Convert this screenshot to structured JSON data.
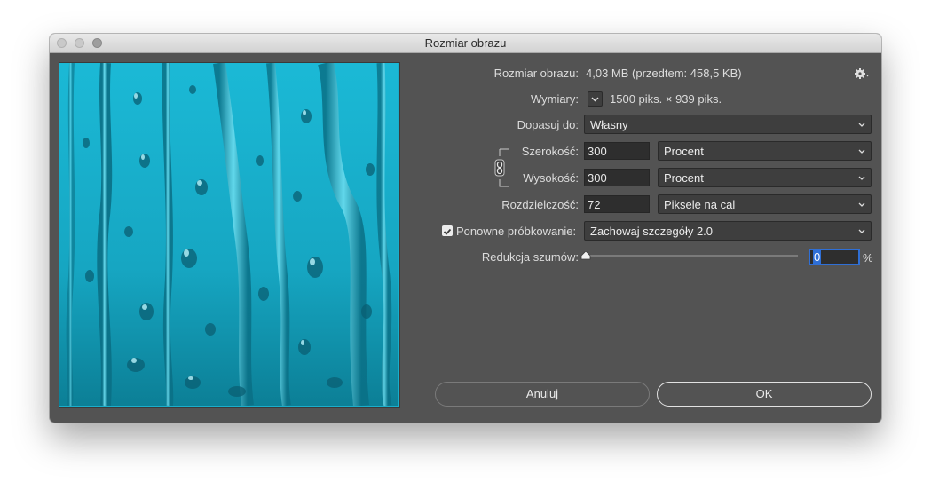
{
  "window": {
    "title": "Rozmiar obrazu"
  },
  "info": {
    "image_size_label": "Rozmiar obrazu:",
    "image_size_value": "4,03 MB (przedtem: 458,5 KB)",
    "dimensions_label": "Wymiary:",
    "dimensions_value": "1500 piks. × 939 piks."
  },
  "fit_to": {
    "label": "Dopasuj do:",
    "value": "Własny"
  },
  "width": {
    "label": "Szerokość:",
    "value": "300",
    "unit": "Procent"
  },
  "height": {
    "label": "Wysokość:",
    "value": "300",
    "unit": "Procent"
  },
  "resolution": {
    "label": "Rozdzielczość:",
    "value": "72",
    "unit": "Piksele na cal"
  },
  "resample": {
    "label": "Ponowne próbkowanie:",
    "checked": true,
    "method": "Zachowaj szczegóły 2.0"
  },
  "noise": {
    "label": "Redukcja szumów:",
    "value": "0",
    "unit": "%",
    "slider_level": 0
  },
  "buttons": {
    "cancel": "Anuluj",
    "ok": "OK"
  },
  "icons": {
    "settings": "gear-icon",
    "dimensions_toggle": "chevron-down-icon",
    "link": "chain-link-icon",
    "checkbox": "checkmark-icon"
  },
  "colors": {
    "dialog_bg": "#535353",
    "focus": "#2f6fd6",
    "preview_water": "#1aaecb"
  }
}
